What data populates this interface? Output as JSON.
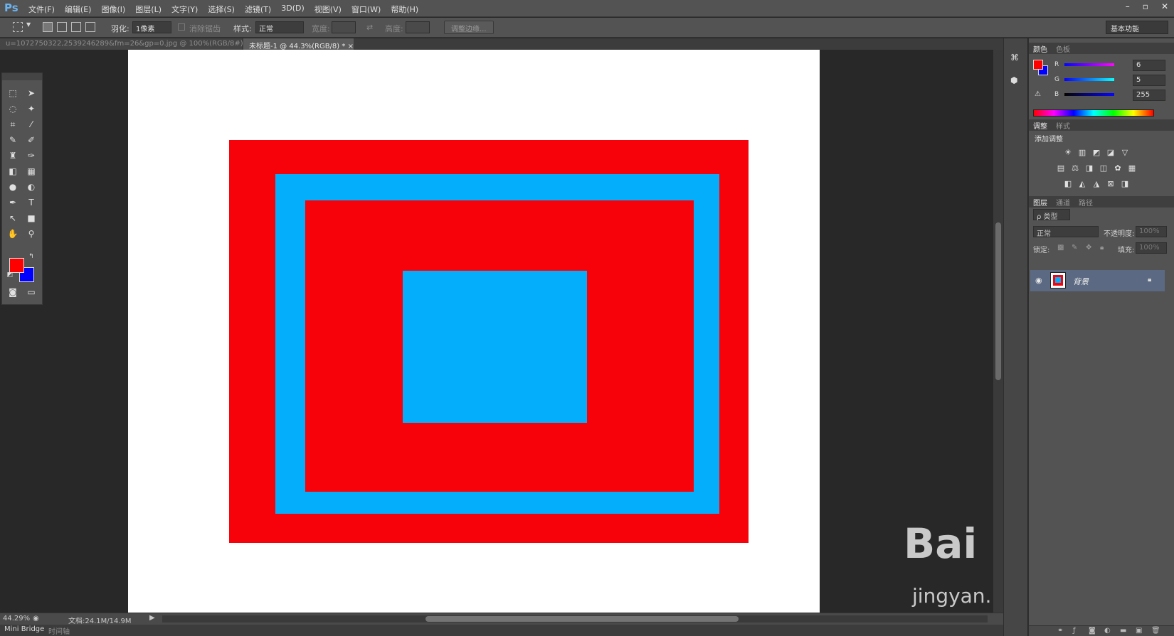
{
  "app": {
    "logo": "Ps"
  },
  "menu": [
    "文件(F)",
    "编辑(E)",
    "图像(I)",
    "图层(L)",
    "文字(Y)",
    "选择(S)",
    "滤镜(T)",
    "3D(D)",
    "视图(V)",
    "窗口(W)",
    "帮助(H)"
  ],
  "window_controls": [
    "–",
    "▫",
    "✕"
  ],
  "options": {
    "feather_label": "羽化:",
    "feather_value": "1像素",
    "antialias_label": "消除锯齿",
    "style_label": "样式:",
    "style_value": "正常",
    "width_label": "宽度:",
    "height_label": "高度:",
    "refine_edge": "调整边缘...",
    "workspace": "基本功能"
  },
  "tabs": [
    {
      "title": "u=1072750322,2539246289&fm=26&gp=0.jpg @ 100%(RGB/8#)",
      "close": "×"
    },
    {
      "title": "未标题-1 @ 44.3%(RGB/8) *",
      "close": "×"
    }
  ],
  "tools": {
    "foreground_color": "#ff0000",
    "background_color": "#0000ff"
  },
  "canvas": {
    "background": "#ffffff",
    "colors": {
      "red": "#f7020a",
      "blue": "#05aefa"
    }
  },
  "status": {
    "zoom": "44.29%",
    "doc_info": "文档:24.1M/14.9M",
    "bottom_tabs": [
      "Mini Bridge",
      "时间轴"
    ]
  },
  "color_panel": {
    "tabs": [
      "颜色",
      "色板"
    ],
    "r_label": "R",
    "r_value": "6",
    "g_label": "G",
    "g_value": "5",
    "b_label": "B",
    "b_value": "255",
    "fg": "#ff0000",
    "bg": "#0000ff"
  },
  "adjustments_panel": {
    "tabs": [
      "调整",
      "样式"
    ],
    "heading": "添加调整"
  },
  "layers_panel": {
    "tabs": [
      "图层",
      "通道",
      "路径"
    ],
    "filter_label": "ρ 类型",
    "blend_mode": "正常",
    "opacity_label": "不透明度:",
    "opacity_value": "100%",
    "lock_label": "锁定:",
    "fill_label": "填充:",
    "fill_value": "100%",
    "layer_name": "背景"
  },
  "watermark": {
    "brand": "Bai du 经验",
    "url": "jingyan.baidu.com"
  }
}
